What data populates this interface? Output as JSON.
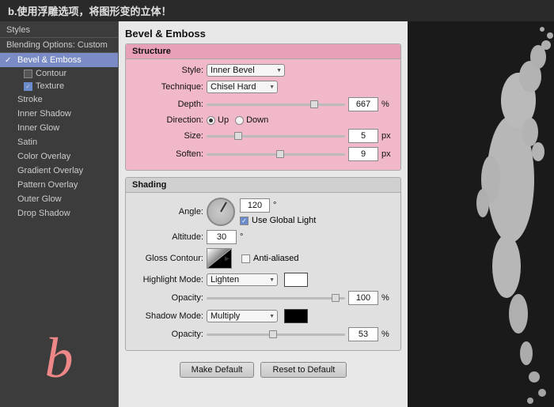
{
  "topBar": {
    "text": "b.使用浮雕选项，将图形变的立体！"
  },
  "sidebar": {
    "stylesLabel": "Styles",
    "blendingLabel": "Blending Options: Custom",
    "items": [
      {
        "id": "bevel-emboss",
        "label": "Bevel & Emboss",
        "active": true,
        "checked": true
      },
      {
        "id": "contour",
        "label": "Contour",
        "active": false,
        "checked": false,
        "sub": true
      },
      {
        "id": "texture",
        "label": "Texture",
        "active": false,
        "checked": true,
        "sub": true
      },
      {
        "id": "stroke",
        "label": "Stroke",
        "active": false,
        "checked": false
      },
      {
        "id": "inner-shadow",
        "label": "Inner Shadow",
        "active": false,
        "checked": false
      },
      {
        "id": "inner-glow",
        "label": "Inner Glow",
        "active": false,
        "checked": false
      },
      {
        "id": "satin",
        "label": "Satin",
        "active": false,
        "checked": false
      },
      {
        "id": "color-overlay",
        "label": "Color Overlay",
        "active": false,
        "checked": false
      },
      {
        "id": "gradient-overlay",
        "label": "Gradient Overlay",
        "active": false,
        "checked": false
      },
      {
        "id": "pattern-overlay",
        "label": "Pattern Overlay",
        "active": false,
        "checked": false
      },
      {
        "id": "outer-glow",
        "label": "Outer Glow",
        "active": false,
        "checked": false
      },
      {
        "id": "drop-shadow",
        "label": "Drop Shadow",
        "active": false,
        "checked": false
      }
    ],
    "bLetter": "b"
  },
  "panel": {
    "title": "Bevel & Emboss",
    "structure": {
      "header": "Structure",
      "styleLabel": "Style:",
      "styleValue": "Inner Bevel",
      "techniqueLabel": "Technique:",
      "techniqueValue": "Chisel Hard",
      "depthLabel": "Depth:",
      "depthValue": "667",
      "depthUnit": "%",
      "depthSliderPos": "75",
      "directionLabel": "Direction:",
      "directionUp": "Up",
      "directionDown": "Down",
      "sizeLabel": "Size:",
      "sizeValue": "5",
      "sizeUnit": "px",
      "sizeSliderPos": "20",
      "softenLabel": "Soften:",
      "softenValue": "9",
      "softenUnit": "px",
      "softenSliderPos": "50"
    },
    "shading": {
      "header": "Shading",
      "angleLabel": "Angle:",
      "angleValue": "120",
      "angleUnit": "°",
      "useGlobalLight": "Use Global Light",
      "altitudeLabel": "Altitude:",
      "altitudeValue": "30",
      "altitudeUnit": "°",
      "glossContourLabel": "Gloss Contour:",
      "antiAliased": "Anti-aliased",
      "highlightModeLabel": "Highlight Mode:",
      "highlightModeValue": "Lighten",
      "highlightOpacityLabel": "Opacity:",
      "highlightOpacityValue": "100",
      "highlightOpacityUnit": "%",
      "highlightOpacitySliderPos": "90",
      "shadowModeLabel": "Shadow Mode:",
      "shadowModeValue": "Multiply",
      "shadowOpacityLabel": "Opacity:",
      "shadowOpacityValue": "53",
      "shadowOpacityUnit": "%",
      "shadowOpacitySliderPos": "45"
    },
    "buttons": {
      "makeDefault": "Make Default",
      "resetToDefault": "Reset to Default"
    }
  }
}
